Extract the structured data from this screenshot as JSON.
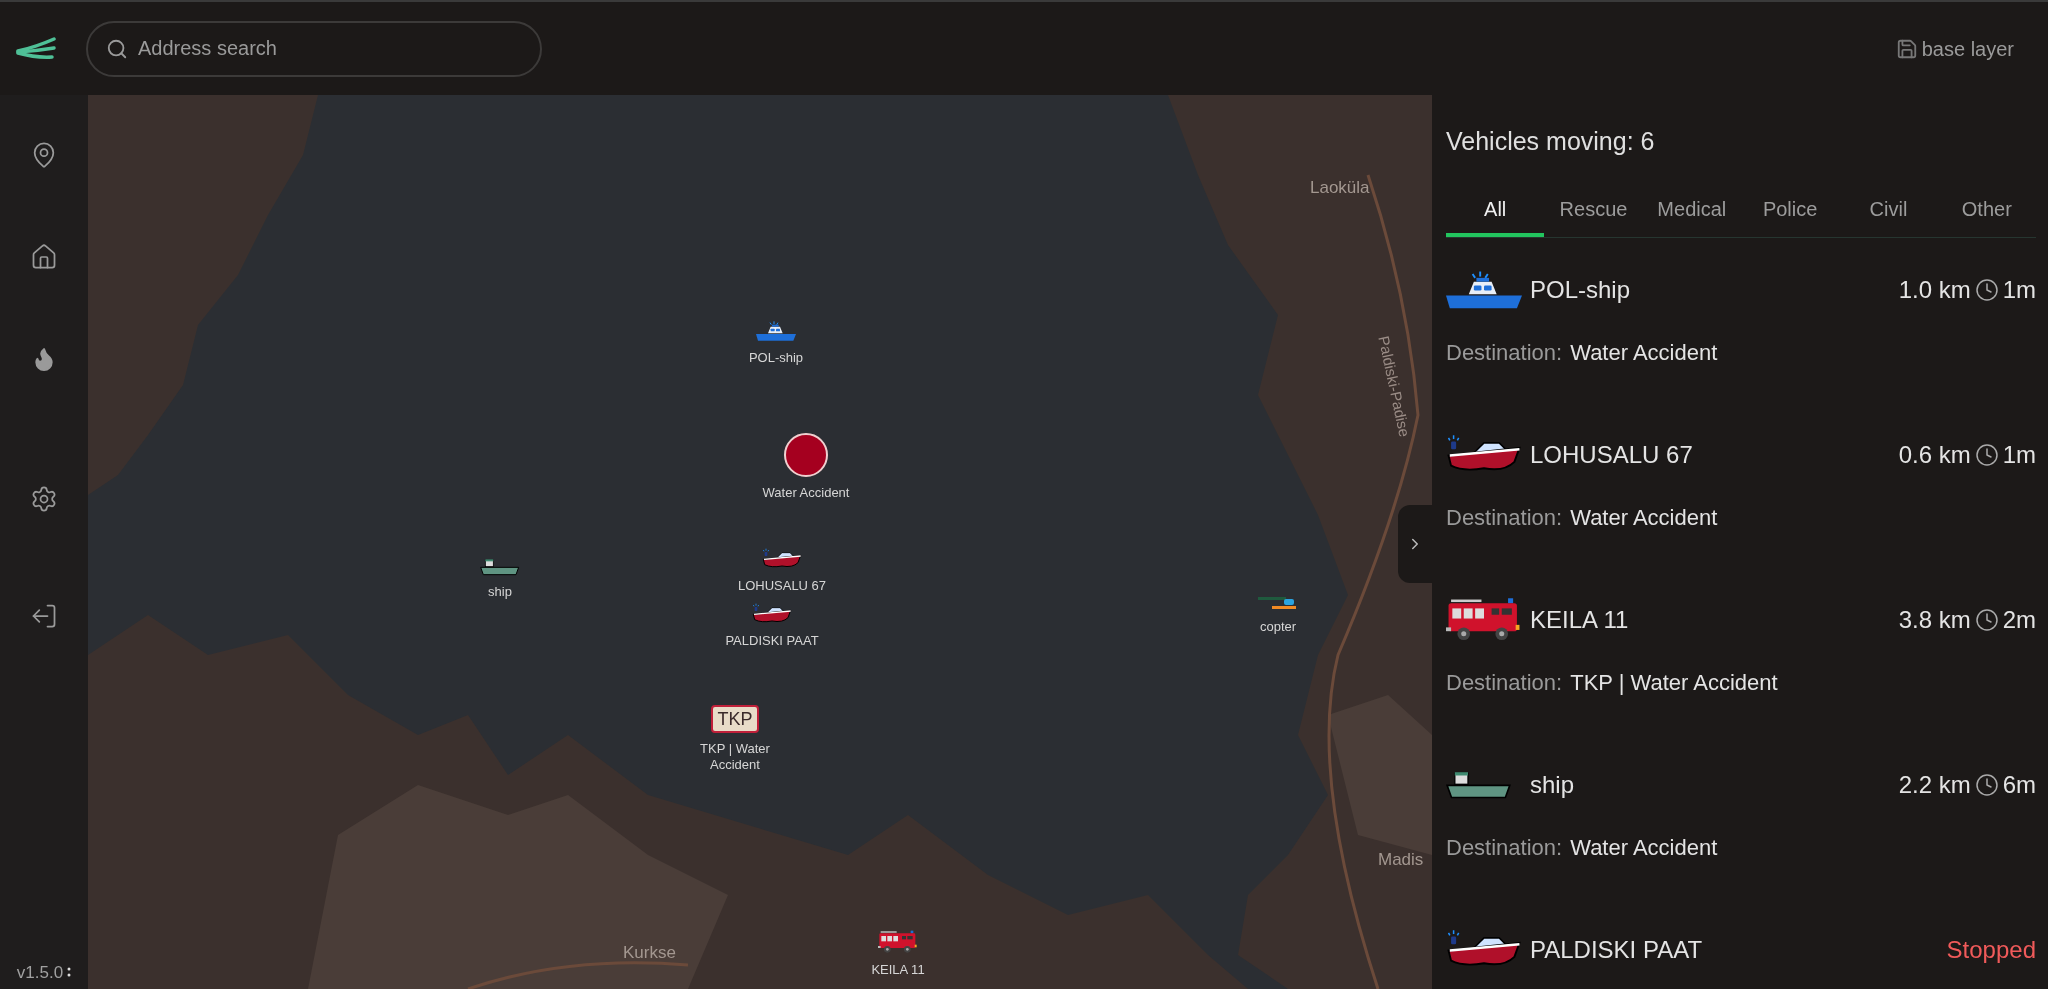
{
  "header": {
    "search": {
      "placeholder": "Address search"
    },
    "base_layer": "base layer"
  },
  "sidebar": {
    "version": "v1.5.0"
  },
  "map": {
    "places": [
      {
        "label": "Laoküla",
        "kind": "village"
      },
      {
        "label": "Paldiski-Padise",
        "kind": "road"
      },
      {
        "label": "Madis",
        "kind": "village"
      },
      {
        "label": "Kurkse",
        "kind": "village"
      }
    ],
    "markers": [
      {
        "label": "POL-ship",
        "kind": "police_boat"
      },
      {
        "label": "Water Accident",
        "kind": "incident"
      },
      {
        "label": "ship",
        "kind": "ship"
      },
      {
        "label": "LOHUSALU 67",
        "kind": "rescue_boat"
      },
      {
        "label": "PALDISKI PAAT",
        "kind": "rescue_boat"
      },
      {
        "label": "copter",
        "kind": "copter"
      },
      {
        "label": "TKP | Water Accident",
        "kind": "post",
        "badge": "TKP"
      },
      {
        "label": "KEILA 11",
        "kind": "fire_truck"
      }
    ]
  },
  "panel": {
    "title": "Vehicles moving: 6",
    "tabs": [
      {
        "label": "All",
        "selected": true
      },
      {
        "label": "Rescue",
        "selected": false
      },
      {
        "label": "Medical",
        "selected": false
      },
      {
        "label": "Police",
        "selected": false
      },
      {
        "label": "Civil",
        "selected": false
      },
      {
        "label": "Other",
        "selected": false
      }
    ],
    "vehicles": [
      {
        "name": "POL-ship",
        "kind": "police_boat",
        "stopped": false,
        "distance": "1.0 km",
        "eta": "1m",
        "destination_label": "Destination:",
        "destination": "Water Accident"
      },
      {
        "name": "LOHUSALU 67",
        "kind": "rescue_boat",
        "stopped": false,
        "distance": "0.6 km",
        "eta": "1m",
        "destination_label": "Destination:",
        "destination": "Water Accident"
      },
      {
        "name": "KEILA 11",
        "kind": "fire_truck",
        "stopped": false,
        "distance": "3.8 km",
        "eta": "2m",
        "destination_label": "Destination:",
        "destination": "TKP | Water Accident"
      },
      {
        "name": "ship",
        "kind": "ship",
        "stopped": false,
        "distance": "2.2 km",
        "eta": "6m",
        "destination_label": "Destination:",
        "destination": "Water Accident"
      },
      {
        "name": "PALDISKI PAAT",
        "kind": "rescue_boat",
        "stopped": true,
        "status": "Stopped"
      }
    ]
  }
}
